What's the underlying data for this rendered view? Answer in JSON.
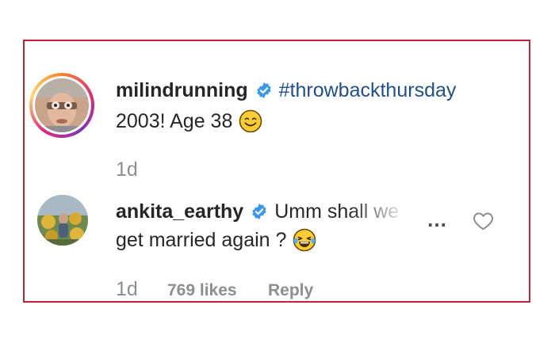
{
  "post": {
    "username": "milindrunning",
    "hashtag": "#throwbackthursday",
    "caption": "2003! Age 38",
    "caption_emoji": "smiling-face-emoji",
    "time": "1d"
  },
  "comment": {
    "username": "ankita_earthy",
    "text_line1": "Umm shall we",
    "text_line2": "get married again ?",
    "emoji": "laughing-tears-emoji",
    "time": "1d",
    "likes": "769 likes",
    "reply_label": "Reply"
  },
  "icons": {
    "verified": "verified-badge-icon",
    "more": "more-options-icon",
    "like": "heart-icon"
  },
  "colors": {
    "frame_border": "#c4213a",
    "verified_blue": "#3897f0",
    "hashtag": "#1f4f8f",
    "muted": "#8e8e8e"
  }
}
